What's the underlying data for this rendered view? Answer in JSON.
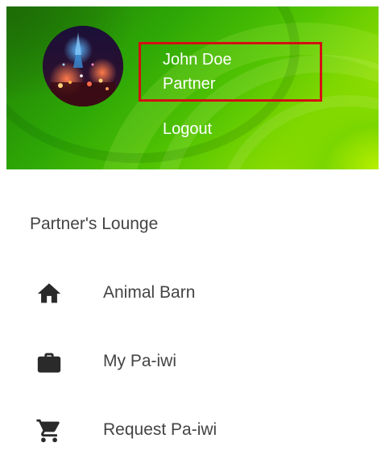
{
  "header": {
    "user_name": "John Doe",
    "user_role": "Partner",
    "logout_label": "Logout",
    "avatar_icon": "user-photo-avatar",
    "highlight_color": "#d40f12"
  },
  "menu": {
    "section_title": "Partner's Lounge",
    "items": [
      {
        "label": "Animal Barn",
        "icon": "home-icon"
      },
      {
        "label": "My Pa-iwi",
        "icon": "briefcase-icon"
      },
      {
        "label": "Request Pa-iwi",
        "icon": "cart-icon"
      }
    ]
  }
}
